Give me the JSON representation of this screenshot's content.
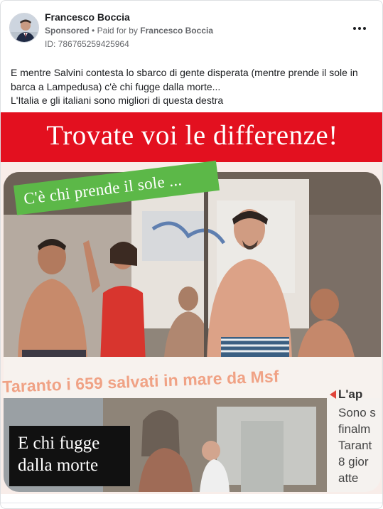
{
  "post": {
    "author": "Francesco Boccia",
    "sponsored_label": "Sponsored",
    "separator": "•",
    "paid_for_prefix": "Paid for by",
    "paid_for_name": "Francesco Boccia",
    "ad_id": "ID: 786765259425964",
    "more_icon": "more-options-icon",
    "text_lines": [
      "E mentre Salvini contesta lo sbarco di gente disperata (mentre prende il sole in",
      "barca a Lampedusa) c'è chi fugge dalla morte...",
      "L'Italia e gli italiani sono migliori di questa destra"
    ]
  },
  "creative": {
    "banner_text": "Trovate voi le differenze!",
    "green_label": "C'è chi prende il sole ...",
    "newspaper_headline": "Taranto i 659 salvati in mare da Msf",
    "aside": {
      "title": "L'ap",
      "lines": [
        "Sono s",
        "finalm",
        "Tarant",
        "8 gior",
        "atte"
      ]
    },
    "black_label_lines": [
      "E chi fugge",
      "dalla morte"
    ],
    "colors": {
      "banner": "#e3101f",
      "green_label": "#5cb848",
      "black_label": "#111111",
      "headline": "#f0a285"
    }
  }
}
